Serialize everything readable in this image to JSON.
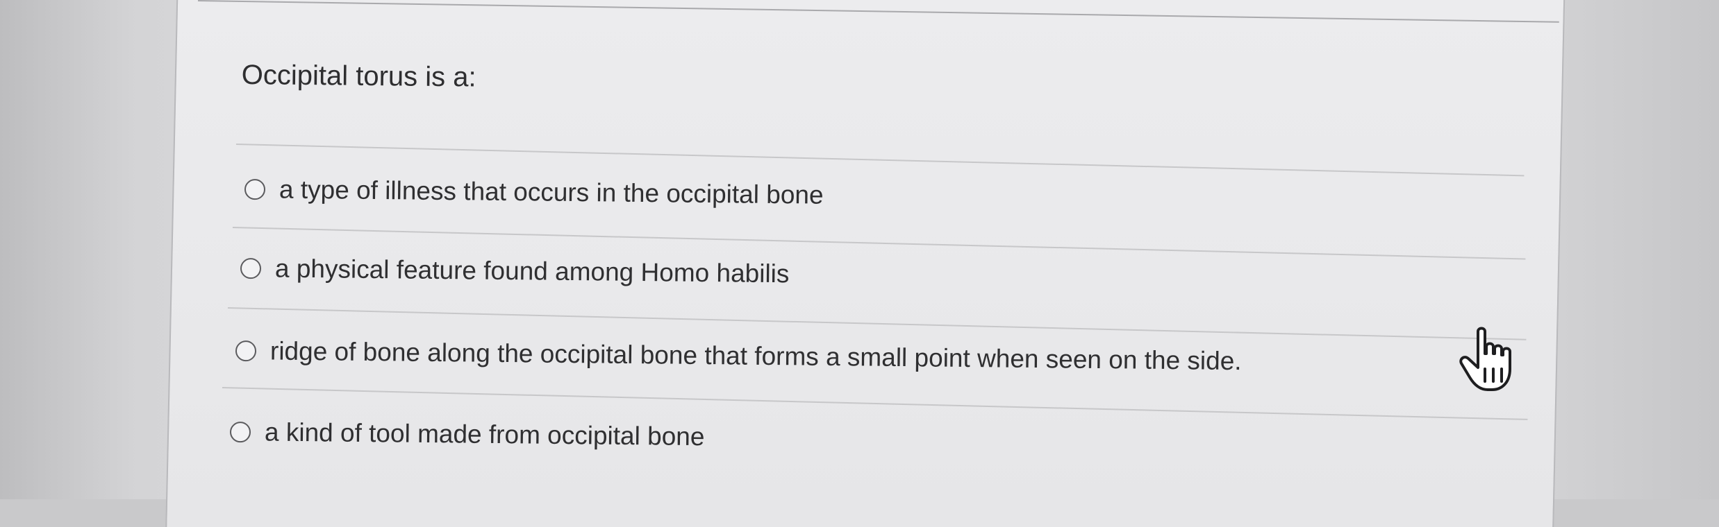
{
  "quiz": {
    "question": "Occipital torus is a:",
    "options": [
      {
        "label": "a type of illness that occurs in the occipital bone",
        "selected": false
      },
      {
        "label": "a physical feature found among Homo habilis",
        "selected": false
      },
      {
        "label": "ridge of bone along the occipital bone that forms a small point when seen on the side.",
        "selected": false
      },
      {
        "label": "a kind of tool made from occipital bone",
        "selected": false
      }
    ]
  },
  "icons": {
    "pointer": "hand-pointer-icon",
    "radio": "radio-unselected-icon"
  },
  "colors": {
    "page_background": "#dedee0",
    "card_background": "#eaeaec",
    "text": "#2e2e30",
    "radio_border": "#5b5b5e",
    "divider": "#c7c7c9"
  }
}
